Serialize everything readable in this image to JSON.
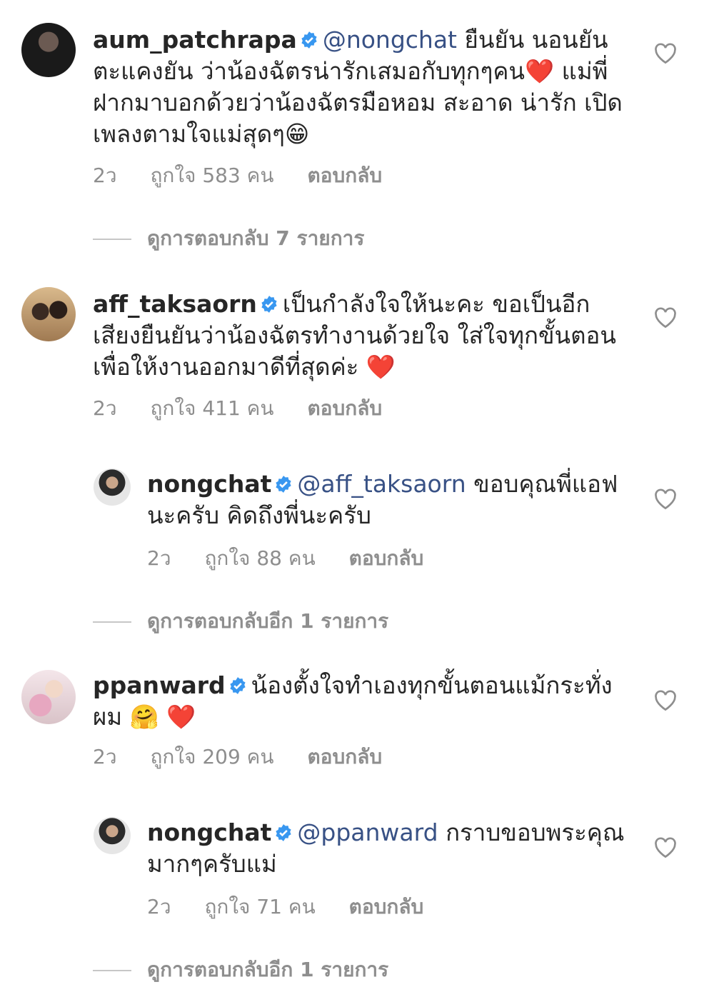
{
  "comments": [
    {
      "username": "aum_patchrapa",
      "mention": "@nongchat",
      "text": "ยืนยัน นอนยัน ตะแคงยัน ว่าน้องฉัตรน่ารักเสมอกับทุกๆคน❤️ แม่พี่ฝากมาบอกด้วยว่าน้องฉัตรมือหอม สะอาด น่ารัก เปิดเพลงตามใจแม่สุดๆ😁",
      "age": "2ว",
      "likes": "ถูกใจ 583 คน",
      "reply_label": "ตอบกลับ",
      "view_replies": "ดูการตอบกลับ 7 รายการ"
    },
    {
      "username": "aff_taksaorn",
      "mention": "",
      "text": "เป็นกำลังใจให้นะคะ ขอเป็นอีกเสียงยืนยันว่าน้องฉัตรทำงานด้วยใจ ใส่ใจทุกขั้นตอน เพื่อให้งานออกมาดีที่สุดค่ะ ❤️",
      "age": "2ว",
      "likes": "ถูกใจ 411 คน",
      "reply_label": "ตอบกลับ",
      "reply": {
        "username": "nongchat",
        "mention": "@aff_taksaorn",
        "text": "ขอบคุณพี่แอฟนะครับ คิดถึงพี่นะครับ",
        "age": "2ว",
        "likes": "ถูกใจ 88 คน",
        "reply_label": "ตอบกลับ"
      },
      "view_replies": "ดูการตอบกลับอีก 1 รายการ"
    },
    {
      "username": "ppanward",
      "mention": "",
      "text": "น้องตั้งใจทำเองทุกขั้นตอนแม้กระทั่งผม 🤗 ❤️",
      "age": "2ว",
      "likes": "ถูกใจ 209 คน",
      "reply_label": "ตอบกลับ",
      "reply": {
        "username": "nongchat",
        "mention": "@ppanward",
        "text": "กราบขอบพระคุณมากๆครับแม่",
        "age": "2ว",
        "likes": "ถูกใจ 71 คน",
        "reply_label": "ตอบกลับ"
      },
      "view_replies": "ดูการตอบกลับอีก 1 รายการ"
    }
  ],
  "colors": {
    "text": "#262626",
    "secondary": "#8e8e8e",
    "mention": "#385185",
    "verified": "#3897f0"
  }
}
